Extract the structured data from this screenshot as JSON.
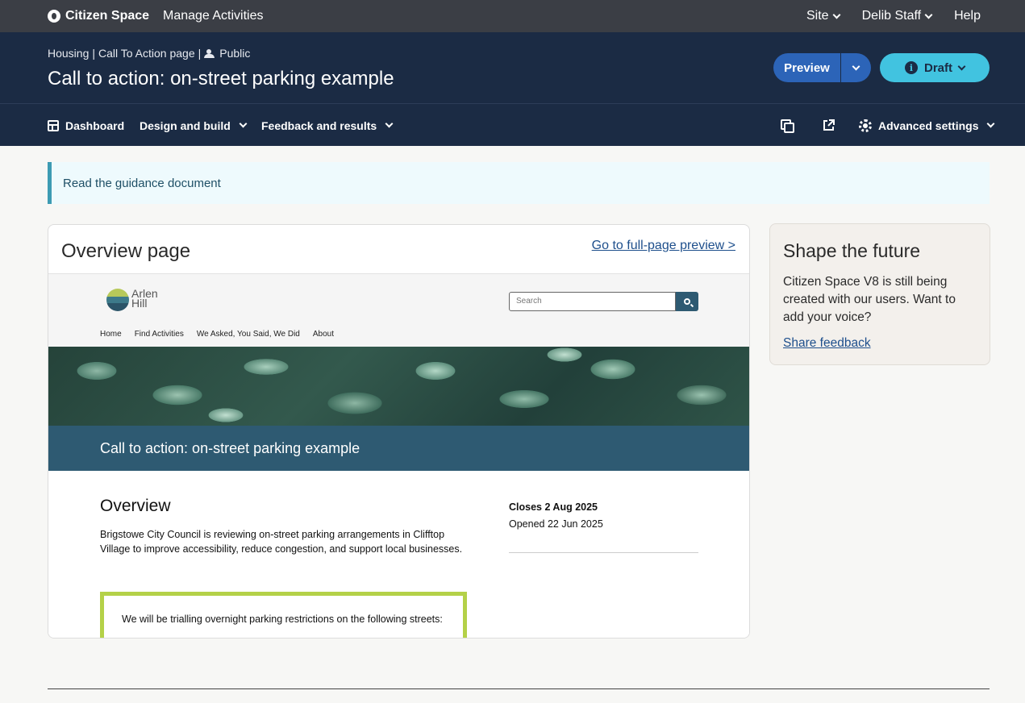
{
  "topbar": {
    "brand": "Citizen Space",
    "manage": "Manage Activities",
    "site": "Site",
    "user": "Delib Staff",
    "help": "Help"
  },
  "header": {
    "crumb_section": "Housing",
    "crumb_type": "Call To Action page",
    "crumb_visibility": "Public",
    "separator": "|",
    "title": "Call to action: on-street parking example",
    "preview_label": "Preview",
    "status_label": "Draft",
    "info_glyph": "i"
  },
  "subnav": {
    "dashboard": "Dashboard",
    "design": "Design and build",
    "feedback": "Feedback and results",
    "advanced": "Advanced settings"
  },
  "guidance": {
    "prefix": "Read the",
    "link": "guidance document"
  },
  "overview_card": {
    "title": "Overview page",
    "link": "Go to full-page preview >"
  },
  "preview_site": {
    "logo_line1": "Arlen",
    "logo_line2": "Hill",
    "search_placeholder": "Search",
    "nav": [
      "Home",
      "Find Activities",
      "We Asked, You Said, We Did",
      "About"
    ],
    "banner_title": "Call to action: on-street parking example",
    "overview_heading": "Overview",
    "overview_text": "Brigstowe City Council is reviewing on-street parking arrangements in Clifftop Village to improve accessibility, reduce congestion, and support local businesses.",
    "callout_text": "We will be trialling overnight parking restrictions on the following streets:",
    "closes": "Closes 2 Aug 2025",
    "opened": "Opened 22 Jun 2025"
  },
  "side_card": {
    "title": "Shape the future",
    "text": "Citizen Space V8 is still being created with our users. Want to add your voice?",
    "link": "Share feedback"
  },
  "colors": {
    "topbar": "#3b3e45",
    "header": "#1b2b44",
    "preview_button": "#2c64b8",
    "draft_button": "#41c3e0",
    "banner_band": "#2e5a72",
    "callout_border": "#b4d148"
  },
  "icons": {
    "brand": "citizen-space-logo-icon",
    "people": "people-icon",
    "dashboard": "dashboard-grid-icon",
    "copy": "copy-icon",
    "external": "external-link-icon",
    "gear": "gear-icon",
    "info": "info-icon",
    "search": "search-icon"
  }
}
